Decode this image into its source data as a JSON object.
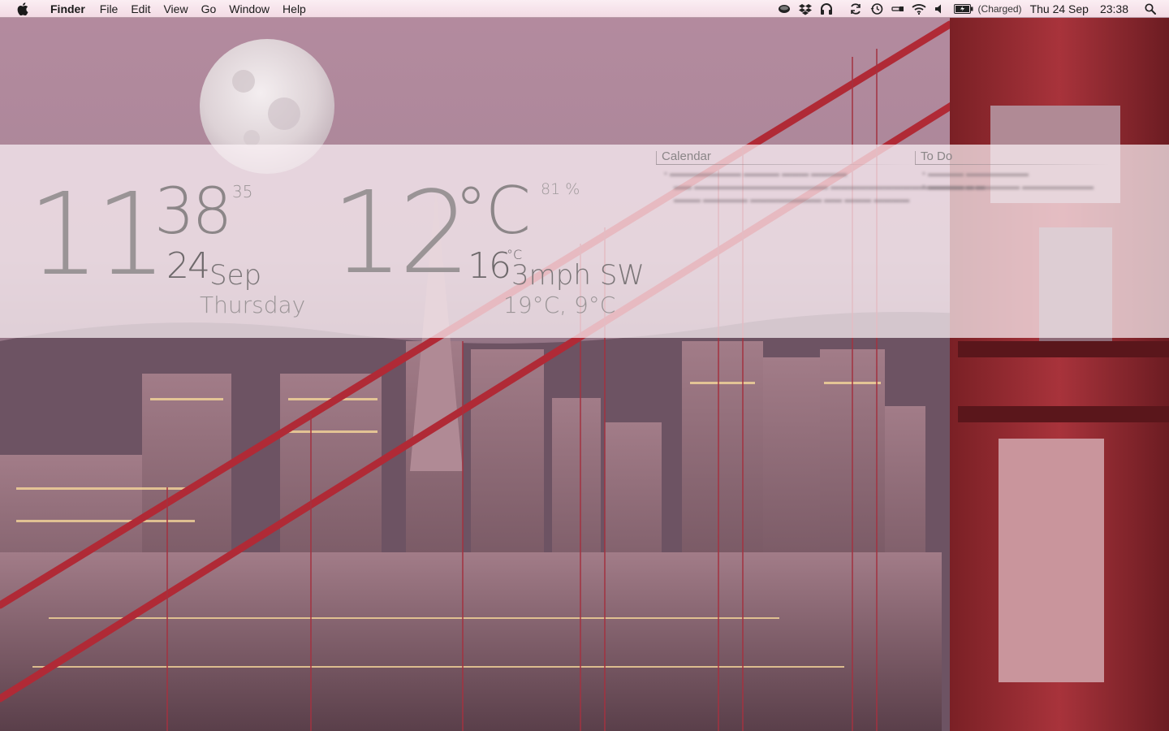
{
  "menubar": {
    "app_name": "Finder",
    "menus": [
      "File",
      "Edit",
      "View",
      "Go",
      "Window",
      "Help"
    ],
    "status_icons": [
      "coffee-icon",
      "dropbox-icon",
      "headphones-icon",
      "sync-icon",
      "time-machine-icon",
      "usb-icon",
      "wifi-icon",
      "volume-icon",
      "battery-icon",
      "spotlight-icon"
    ],
    "battery_status": "(Charged)",
    "date": "Thu 24 Sep",
    "time": "23:38"
  },
  "clock_widget": {
    "hour": "11",
    "minute": "38",
    "second": "35",
    "day": "24",
    "month": "Sep",
    "weekday": "Thursday"
  },
  "weather_widget": {
    "temperature": "12",
    "unit": "°C",
    "humidity": "81 %",
    "feels_like": "16",
    "feels_unit": "°C",
    "wind": "3mph SW",
    "high_low": "19°C, 9°C"
  },
  "calendar_panel": {
    "title": "Calendar"
  },
  "todo_panel": {
    "title": "To Do"
  },
  "colors": {
    "menubar_bg": "#f6e3ea",
    "band_bg": "#fcf2f6",
    "widget_text": "#9a9496",
    "bridge_red": "#c0303a"
  }
}
